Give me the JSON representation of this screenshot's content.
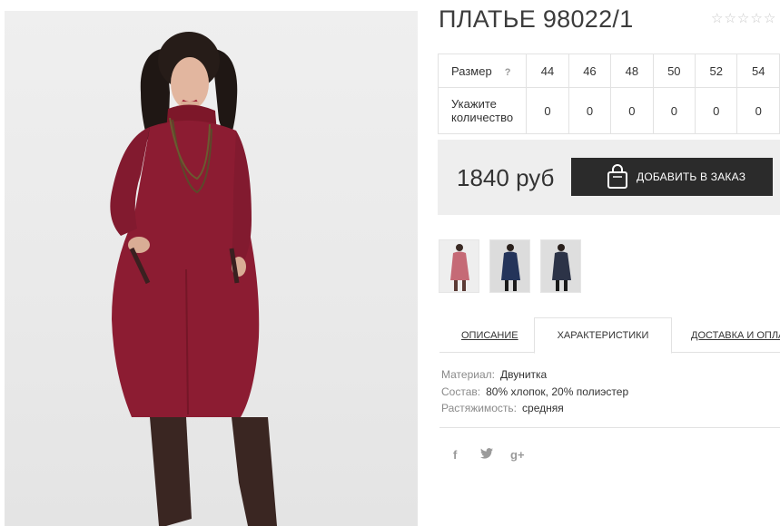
{
  "product": {
    "title": "ПЛАТЬЕ 98022/1",
    "rating_stars": 5,
    "price": "1840 руб",
    "add_to_order_label": "ДОБАВИТЬ В ЗАКАЗ"
  },
  "sizes": {
    "size_label": "Размер",
    "help_mark": "?",
    "qty_label_line1": "Укажите",
    "qty_label_line2": "количество",
    "items": [
      {
        "size": "44",
        "qty": "0"
      },
      {
        "size": "46",
        "qty": "0"
      },
      {
        "size": "48",
        "qty": "0"
      },
      {
        "size": "50",
        "qty": "0"
      },
      {
        "size": "52",
        "qty": "0"
      },
      {
        "size": "54",
        "qty": "0"
      }
    ]
  },
  "thumbnails": [
    {
      "color": "#b5525f",
      "name": "burgundy"
    },
    {
      "color": "#24345a",
      "name": "navy"
    },
    {
      "color": "#2c3347",
      "name": "dark-blue"
    }
  ],
  "tabs": {
    "description": "ОПИСАНИЕ",
    "characteristics": "ХАРАКТЕРИСТИКИ",
    "delivery": "ДОСТАВКА И ОПЛА",
    "active": "characteristics"
  },
  "specs": [
    {
      "key": "Материал:",
      "value": "Двунитка"
    },
    {
      "key": "Состав:",
      "value": "80% хлопок, 20% полиэстер"
    },
    {
      "key": "Растяжимость:",
      "value": "средняя"
    }
  ],
  "social": {
    "facebook": "f",
    "twitter": "🐦",
    "googleplus": "g+"
  },
  "colors": {
    "dress": "#8c1c32",
    "button_bg": "#2b2b2b",
    "price_box_bg": "#eeeeee"
  }
}
